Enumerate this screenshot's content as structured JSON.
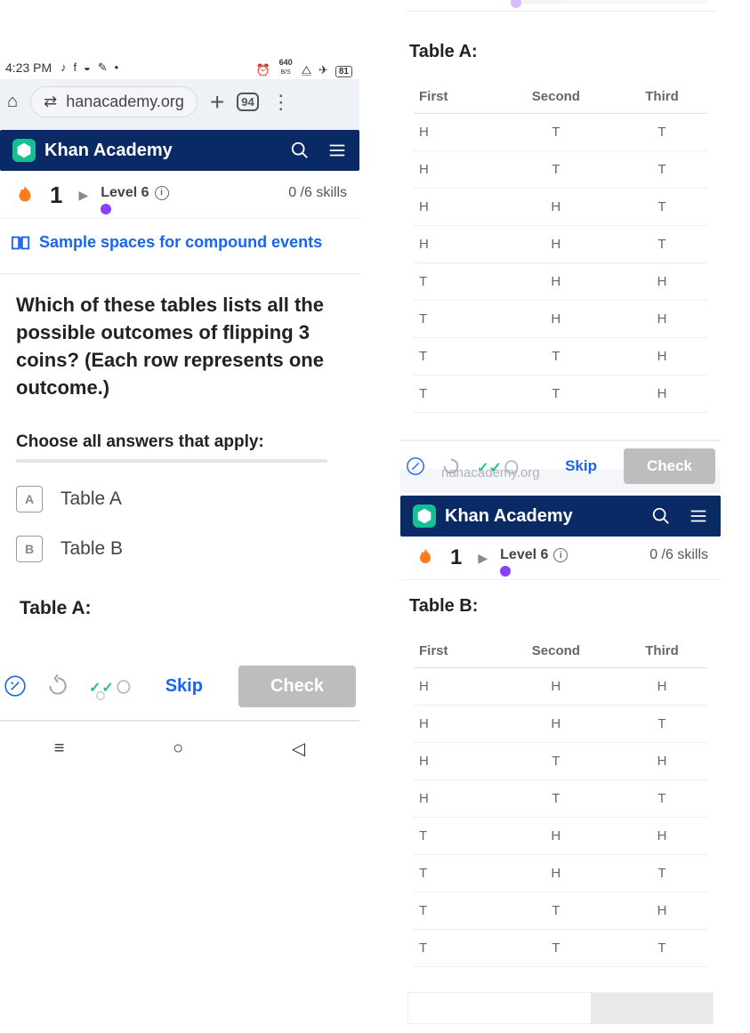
{
  "status": {
    "time": "4:23 PM",
    "net": "640",
    "netUnit": "B/S",
    "batt": "81"
  },
  "browser": {
    "url_host": "hanacademy.org",
    "tab_count": "94"
  },
  "ka": {
    "brand": "Khan Academy",
    "streak": "1",
    "level_label": "Level 6",
    "skills_text": "0 /6 skills"
  },
  "lesson_link": "Sample spaces for compound events",
  "prompt": "Which of these tables lists all the possible outcomes of flipping 3 coins? (Each row represents one outcome.)",
  "choose": "Choose all answers that apply:",
  "answers": [
    {
      "letter": "A",
      "text": "Table A"
    },
    {
      "letter": "B",
      "text": "Table B"
    }
  ],
  "tableA_title": "Table A:",
  "tableB_title": "Table B:",
  "cols": {
    "c1": "First",
    "c2": "Second",
    "c3": "Third"
  },
  "tableA": [
    [
      "H",
      "T",
      "T"
    ],
    [
      "H",
      "T",
      "T"
    ],
    [
      "H",
      "H",
      "T"
    ],
    [
      "H",
      "H",
      "T"
    ],
    [
      "T",
      "H",
      "H"
    ],
    [
      "T",
      "H",
      "H"
    ],
    [
      "T",
      "T",
      "H"
    ],
    [
      "T",
      "T",
      "H"
    ]
  ],
  "tableB": [
    [
      "H",
      "H",
      "H"
    ],
    [
      "H",
      "H",
      "T"
    ],
    [
      "H",
      "T",
      "H"
    ],
    [
      "H",
      "T",
      "T"
    ],
    [
      "T",
      "H",
      "H"
    ],
    [
      "T",
      "H",
      "T"
    ],
    [
      "T",
      "T",
      "H"
    ],
    [
      "T",
      "T",
      "T"
    ]
  ],
  "footer": {
    "skip": "Skip",
    "check": "Check"
  },
  "ghost_url": "nanacademy.org"
}
